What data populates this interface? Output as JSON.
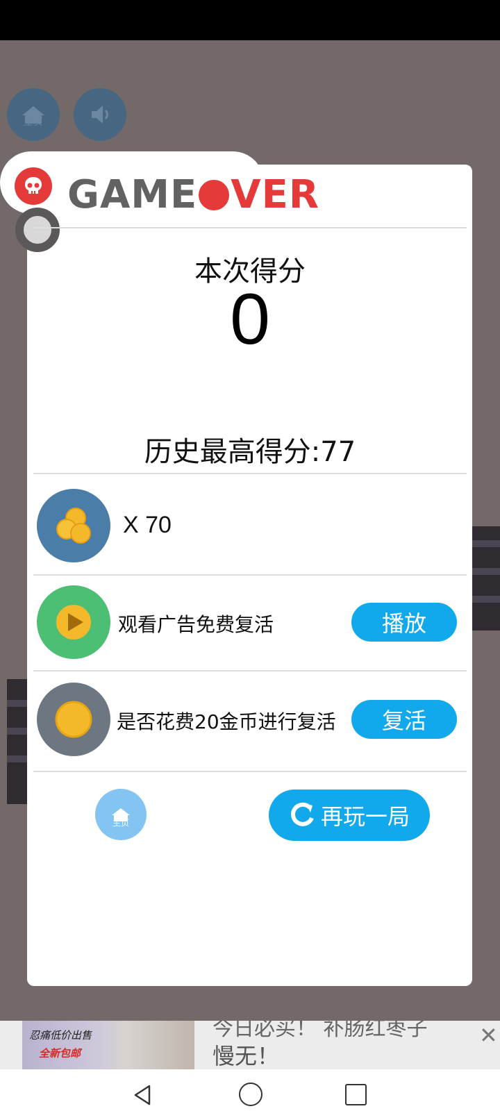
{
  "game_over": {
    "title_prefix": "GAME",
    "title_suffix": "VER"
  },
  "score": {
    "label": "本次得分",
    "value": "0",
    "best_label": "历史最高得分:77"
  },
  "coins": {
    "count_label": "X 70"
  },
  "revive_ad": {
    "text": "观看广告免费复活",
    "button_label": "播放"
  },
  "revive_coins": {
    "text": "是否花费20金币进行复活",
    "button_label": "复活"
  },
  "bottom": {
    "home_label": "主页",
    "replay_label": "再玩一局"
  },
  "top_buttons": {
    "home_label": "主页"
  },
  "ad": {
    "image_line1": "忍痛低价出售",
    "image_line2": "全新包邮",
    "headline_partial": "今日必买！ 补肠红枣子",
    "headline_line2": "慢无！",
    "close_glyph": "✕"
  },
  "colors": {
    "accent_red": "#e53a3a",
    "button_blue": "#12a9ec",
    "coin_circle": "#4a7ea8",
    "play_circle": "#4dbf74",
    "revive_circle": "#6c7782"
  },
  "icons": [
    "home-icon",
    "sound-icon",
    "skull-icon",
    "coins-icon",
    "play-icon",
    "coin-icon",
    "replay-icon"
  ]
}
